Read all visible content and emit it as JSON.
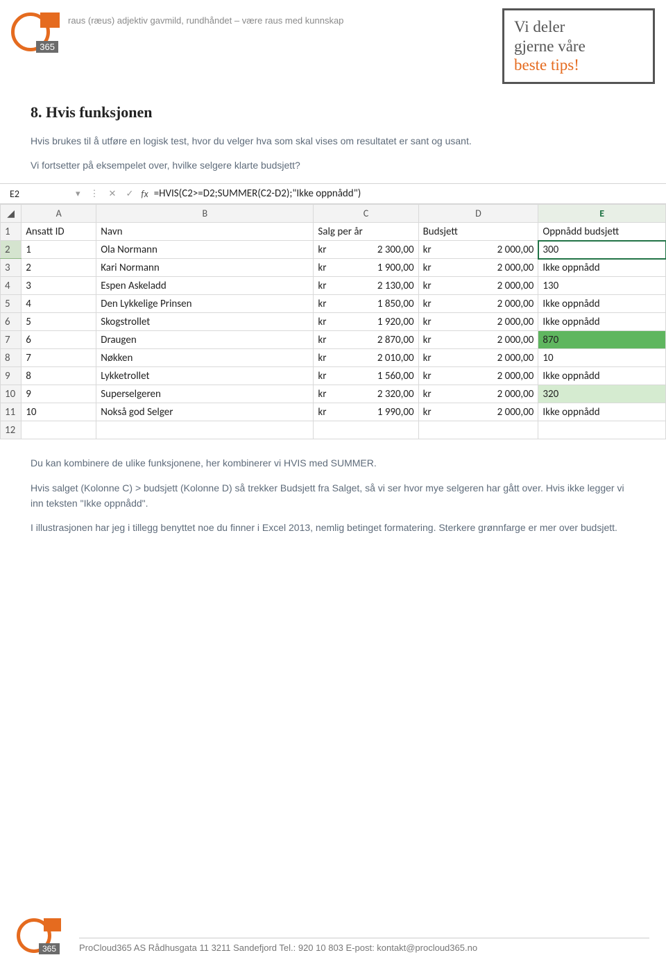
{
  "header": {
    "logo_365": "365",
    "tagline": "raus (ræus) adjektiv gavmild, rundhåndet – være raus med kunnskap",
    "tipbox_line1": "Vi deler",
    "tipbox_line2": "gjerne våre",
    "tipbox_line3": "beste tips!"
  },
  "section_title": "8. Hvis funksjonen",
  "para1": "Hvis brukes til å utføre en logisk test, hvor du velger hva som skal vises om resultatet er sant og usant.",
  "para2": "Vi fortsetter på eksempelet over, hvilke selgere klarte budsjett?",
  "excel": {
    "name_box": "E2",
    "formula": "=HVIS(C2>=D2;SUMMER(C2-D2);\"Ikke oppnådd\")",
    "col_labels": {
      "A": "A",
      "B": "B",
      "C": "C",
      "D": "D",
      "E": "E"
    },
    "headers": {
      "A": "Ansatt ID",
      "B": "Navn",
      "C": "Salg per år",
      "D": "Budsjett",
      "E": "Oppnådd budsjett"
    },
    "rows": [
      {
        "n": "2",
        "id": "1",
        "navn": "Ola Normann",
        "salg": "2 300,00",
        "bud": "2 000,00",
        "opp": "300",
        "cls": "selcell"
      },
      {
        "n": "3",
        "id": "2",
        "navn": "Kari Normann",
        "salg": "1 900,00",
        "bud": "2 000,00",
        "opp": "Ikke oppnådd",
        "cls": ""
      },
      {
        "n": "4",
        "id": "3",
        "navn": "Espen Askeladd",
        "salg": "2 130,00",
        "bud": "2 000,00",
        "opp": "130",
        "cls": "right"
      },
      {
        "n": "5",
        "id": "4",
        "navn": "Den Lykkelige Prinsen",
        "salg": "1 850,00",
        "bud": "2 000,00",
        "opp": "Ikke oppnådd",
        "cls": ""
      },
      {
        "n": "6",
        "id": "5",
        "navn": "Skogstrollet",
        "salg": "1 920,00",
        "bud": "2 000,00",
        "opp": "Ikke oppnådd",
        "cls": ""
      },
      {
        "n": "7",
        "id": "6",
        "navn": "Draugen",
        "salg": "2 870,00",
        "bud": "2 000,00",
        "opp": "870",
        "cls": "greenstrong"
      },
      {
        "n": "8",
        "id": "7",
        "navn": "Nøkken",
        "salg": "2 010,00",
        "bud": "2 000,00",
        "opp": "10",
        "cls": "right"
      },
      {
        "n": "9",
        "id": "8",
        "navn": "Lykketrollet",
        "salg": "1 560,00",
        "bud": "2 000,00",
        "opp": "Ikke oppnådd",
        "cls": ""
      },
      {
        "n": "10",
        "id": "9",
        "navn": "Superselgeren",
        "salg": "2 320,00",
        "bud": "2 000,00",
        "opp": "320",
        "cls": "green2"
      },
      {
        "n": "11",
        "id": "10",
        "navn": "Nokså god Selger",
        "salg": "1 990,00",
        "bud": "2 000,00",
        "opp": "Ikke oppnådd",
        "cls": ""
      }
    ]
  },
  "para3": "Du kan kombinere de ulike funksjonene, her kombinerer vi HVIS med SUMMER.",
  "para4": "Hvis salget (Kolonne C) > budsjett (Kolonne D) så trekker Budsjett fra Salget, så vi ser hvor mye selgeren har gått over. Hvis ikke legger vi inn teksten \"Ikke oppnådd\".",
  "para5": "I illustrasjonen har jeg i tillegg benyttet noe du finner i Excel 2013, nemlig betinget formatering. Sterkere grønnfarge er mer over budsjett.",
  "footer": {
    "text": "ProCloud365 AS   Rådhusgata 11   3211 Sandefjord   Tel.: 920 10 803   E-post: kontakt@procloud365.no"
  },
  "chart_data": {
    "type": "table",
    "title": "Oppnådd budsjett (HVIS/SUMMER example)",
    "columns": [
      "Ansatt ID",
      "Navn",
      "Salg per år (kr)",
      "Budsjett (kr)",
      "Oppnådd budsjett"
    ],
    "rows": [
      [
        1,
        "Ola Normann",
        2300.0,
        2000.0,
        300
      ],
      [
        2,
        "Kari Normann",
        1900.0,
        2000.0,
        "Ikke oppnådd"
      ],
      [
        3,
        "Espen Askeladd",
        2130.0,
        2000.0,
        130
      ],
      [
        4,
        "Den Lykkelige Prinsen",
        1850.0,
        2000.0,
        "Ikke oppnådd"
      ],
      [
        5,
        "Skogstrollet",
        1920.0,
        2000.0,
        "Ikke oppnådd"
      ],
      [
        6,
        "Draugen",
        2870.0,
        2000.0,
        870
      ],
      [
        7,
        "Nøkken",
        2010.0,
        2000.0,
        10
      ],
      [
        8,
        "Lykketrollet",
        1560.0,
        2000.0,
        "Ikke oppnådd"
      ],
      [
        9,
        "Superselgeren",
        2320.0,
        2000.0,
        320
      ],
      [
        10,
        "Nokså god Selger",
        1990.0,
        2000.0,
        "Ikke oppnådd"
      ]
    ]
  }
}
